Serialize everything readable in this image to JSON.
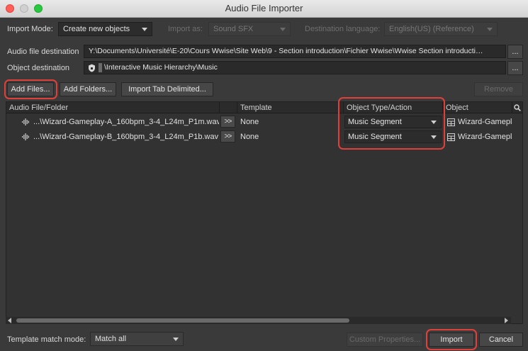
{
  "window": {
    "title": "Audio File Importer"
  },
  "import_mode": {
    "label": "Import Mode:",
    "value": "Create new objects"
  },
  "import_as": {
    "label": "Import as:",
    "value": "Sound SFX"
  },
  "destination_language": {
    "label": "Destination language:",
    "value": "English(US) (Reference)"
  },
  "audio_file_destination": {
    "label": "Audio file destination",
    "value": "Y:\\Documents\\Université\\E-20\\Cours Wwise\\Site Web\\9 - Section introduction\\Fichier Wwise\\Wwise Section introducti…",
    "browse": "..."
  },
  "object_destination": {
    "label": "Object destination",
    "value": "\\Interactive Music Hierarchy\\Music",
    "browse": "..."
  },
  "toolbar": {
    "add_files": "Add Files...",
    "add_folders": "Add Folders...",
    "import_tab_delimited": "Import Tab Delimited...",
    "remove": "Remove"
  },
  "table": {
    "columns": [
      "Audio File/Folder",
      "Template",
      "Object Type/Action",
      "Object"
    ],
    "rows": [
      {
        "file": "...\\Wizard-Gameplay-A_160bpm_3-4_L24m_P1m.wav",
        "arrow": ">>",
        "template": "None",
        "type": "Music Segment",
        "object": "Wizard-Gamepla"
      },
      {
        "file": "...\\Wizard-Gameplay-B_160bpm_3-4_L24m_P1b.wav",
        "arrow": ">>",
        "template": "None",
        "type": "Music Segment",
        "object": "Wizard-Gamepla"
      }
    ]
  },
  "footer": {
    "template_match_label": "Template match mode:",
    "template_match_value": "Match all",
    "custom_properties": "Custom Properties...",
    "import": "Import",
    "cancel": "Cancel"
  }
}
